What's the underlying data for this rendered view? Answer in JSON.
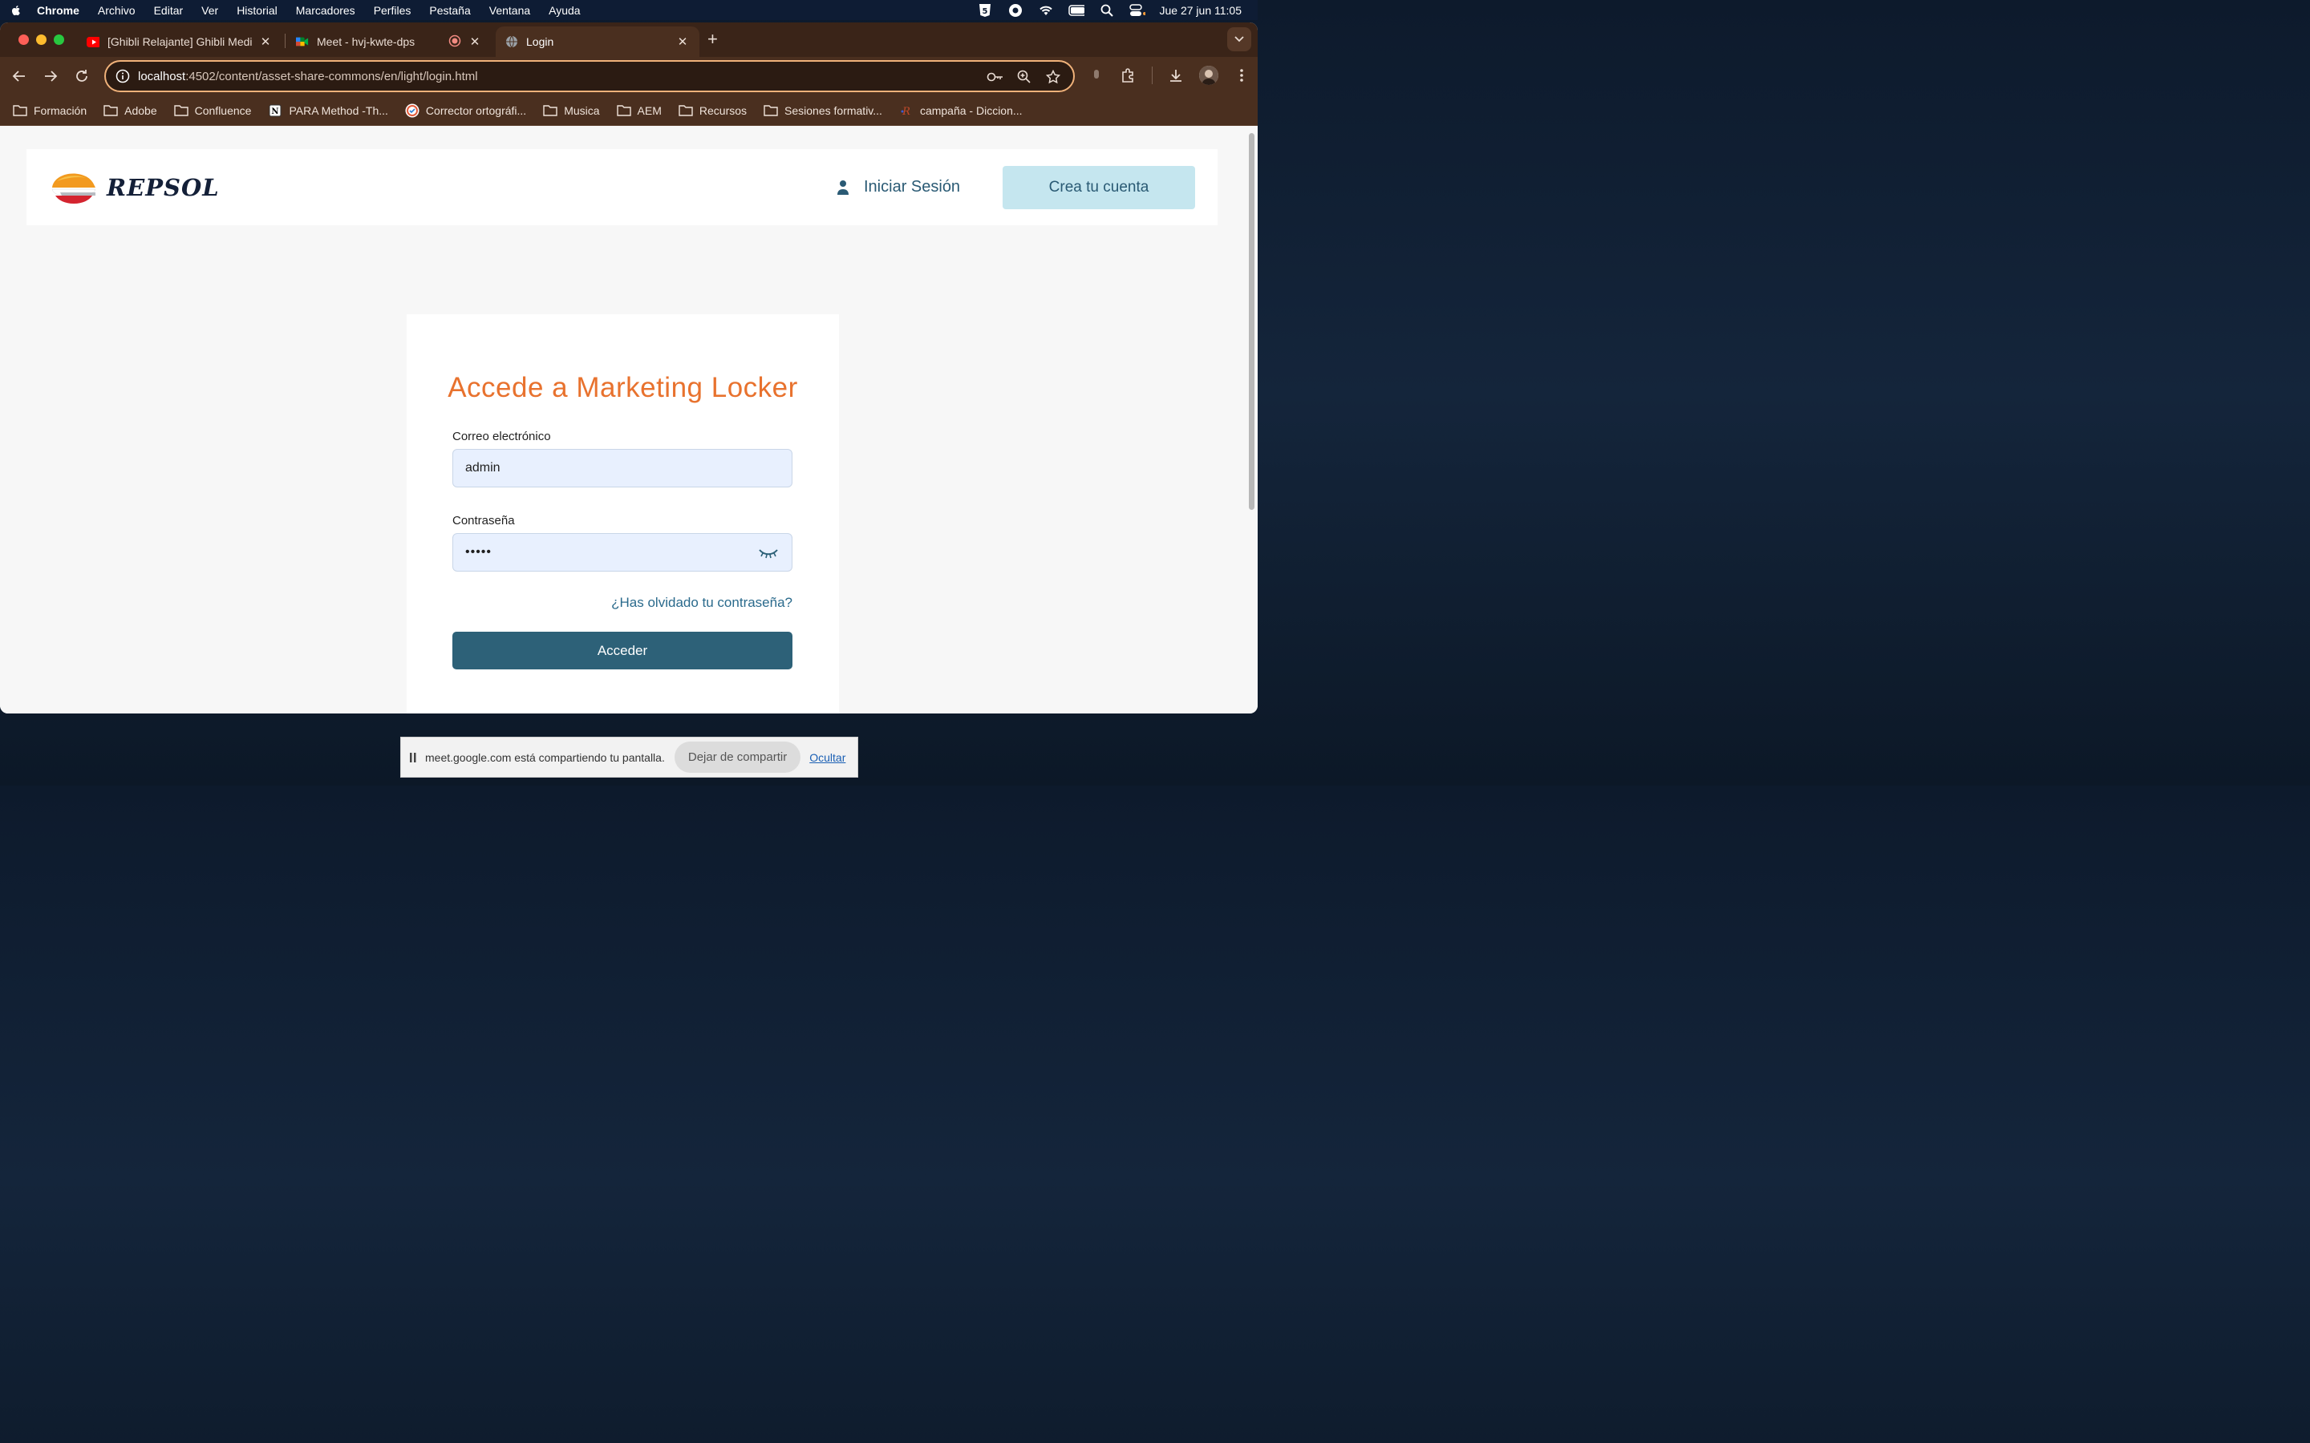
{
  "menubar": {
    "items": [
      "Chrome",
      "Archivo",
      "Editar",
      "Ver",
      "Historial",
      "Marcadores",
      "Perfiles",
      "Pestaña",
      "Ventana",
      "Ayuda"
    ],
    "clock": "Jue 27 jun 11:05"
  },
  "tabs": [
    {
      "title": "[Ghibli Relajante] Ghibli Medi",
      "icon": "youtube-icon"
    },
    {
      "title": "Meet - hvj-kwte-dps",
      "icon": "meet-icon"
    },
    {
      "title": "Login",
      "icon": "globe-icon",
      "active": true
    }
  ],
  "address": {
    "host": "localhost",
    "rest": ":4502/content/asset-share-commons/en/light/login.html"
  },
  "bookmarks": [
    {
      "label": "Formación",
      "icon": "folder-icon"
    },
    {
      "label": "Adobe",
      "icon": "folder-icon"
    },
    {
      "label": "Confluence",
      "icon": "folder-icon"
    },
    {
      "label": "PARA Method -Th...",
      "icon": "notion-icon"
    },
    {
      "label": "Corrector ortográfi...",
      "icon": "corrector-icon"
    },
    {
      "label": "Musica",
      "icon": "folder-icon"
    },
    {
      "label": "AEM",
      "icon": "folder-icon"
    },
    {
      "label": "Recursos",
      "icon": "folder-icon"
    },
    {
      "label": "Sesiones formativ...",
      "icon": "folder-icon"
    },
    {
      "label": "campaña - Diccion...",
      "icon": "rae-icon"
    }
  ],
  "site": {
    "logo_text": "REPSOL",
    "login_link": "Iniciar Sesión",
    "signup_button": "Crea tu cuenta"
  },
  "login_form": {
    "title": "Accede a Marketing Locker",
    "email_label": "Correo electrónico",
    "email_value": "admin",
    "password_label": "Contraseña",
    "password_value": "•••••",
    "forgot_link": "¿Has olvidado tu contraseña?",
    "submit_label": "Acceder"
  },
  "sharebar": {
    "message": "meet.google.com está compartiendo tu pantalla.",
    "stop_label": "Dejar de compartir",
    "hide_label": "Ocultar"
  },
  "colors": {
    "accent_orange": "#e8722e",
    "primary_teal": "#2d6178",
    "cta_light": "#c5e6ef",
    "browser_frame": "#4a2f1f"
  }
}
